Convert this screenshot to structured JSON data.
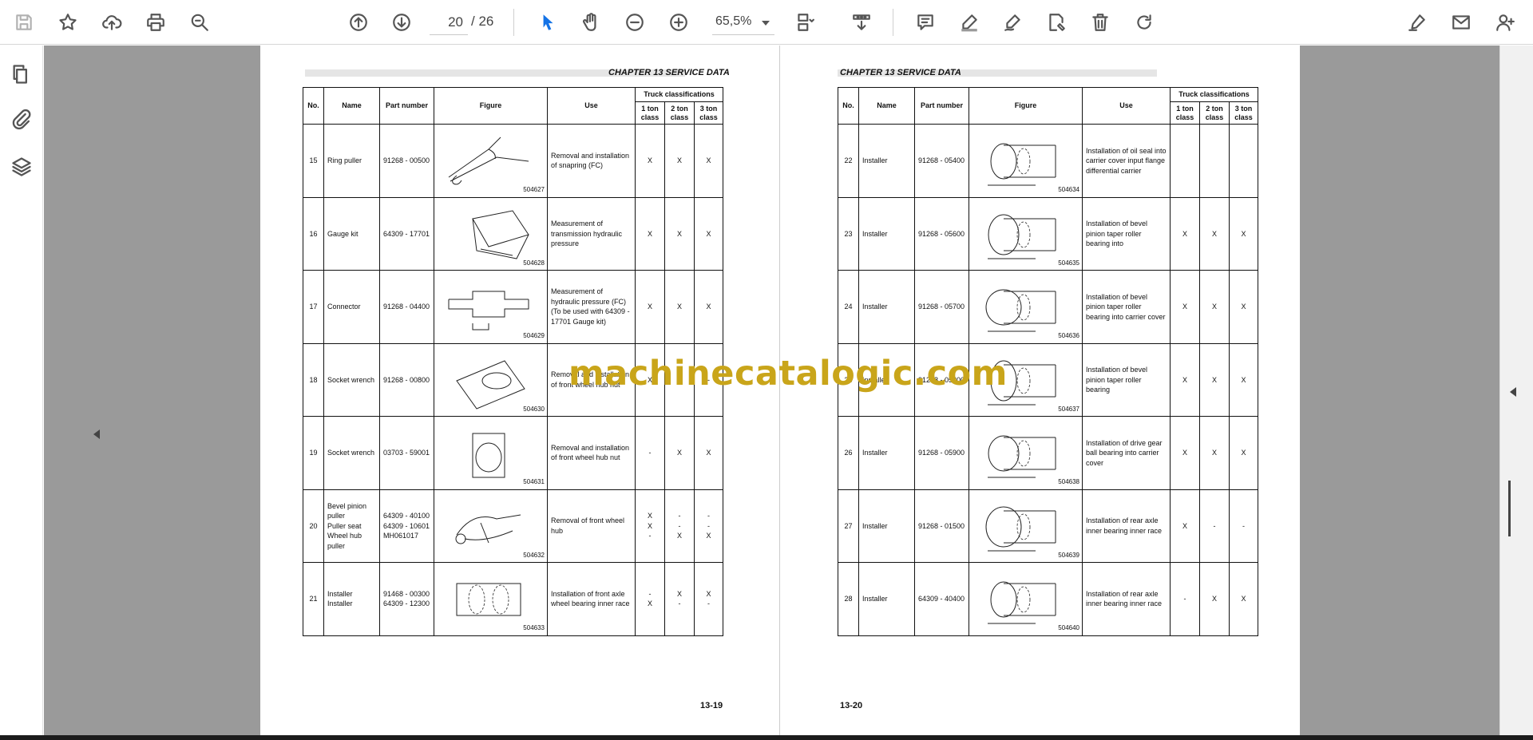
{
  "toolbar": {
    "page_current": "20",
    "page_total": "/  26",
    "zoom": "65,5%",
    "accent": "#1473e6"
  },
  "icons": {
    "toolbar": [
      "save-icon",
      "bookmark-star-icon",
      "upload-cloud-icon",
      "print-icon",
      "find-zoom-icon",
      "page-up-icon",
      "page-down-icon",
      "select-cursor-icon",
      "hand-tool-icon",
      "zoom-out-icon",
      "zoom-in-icon",
      "page-fit-icon",
      "scroll-mode-icon",
      "comment-icon",
      "highlight-pen-icon",
      "draw-icon",
      "stamp-icon",
      "delete-icon",
      "rotate-icon",
      "sign-icon",
      "email-icon",
      "add-user-icon"
    ],
    "sidebar": [
      "pages-icon",
      "attachments-icon",
      "layers-icon"
    ]
  },
  "document": {
    "header": "CHAPTER 13 SERVICE DATA",
    "columns": {
      "no": "No.",
      "name": "Name",
      "part": "Part number",
      "figure": "Figure",
      "use": "Use",
      "truck": "Truck classifications",
      "c1": "1 ton class",
      "c2": "2 ton class",
      "c3": "3 ton class"
    },
    "left_page": {
      "page_number": "13-19",
      "rows": [
        {
          "no": "15",
          "name": "Ring puller",
          "part": "91268 - 00500",
          "fig": "504627",
          "use": "Removal and installation of snapring (FC)",
          "c1": "X",
          "c2": "X",
          "c3": "X"
        },
        {
          "no": "16",
          "name": "Gauge kit",
          "part": "64309 - 17701",
          "fig": "504628",
          "use": "Measurement of transmission hydraulic pressure",
          "c1": "X",
          "c2": "X",
          "c3": "X"
        },
        {
          "no": "17",
          "name": "Connector",
          "part": "91268 - 04400",
          "fig": "504629",
          "use": "Measurement of hydraulic pressure (FC) (To be used with 64309 - 17701 Gauge kit)",
          "c1": "X",
          "c2": "X",
          "c3": "X"
        },
        {
          "no": "18",
          "name": "Socket wrench",
          "part": "91268 - 00800",
          "fig": "504630",
          "use": "Removal and installation of front wheel hub nut",
          "c1": "X",
          "c2": "-",
          "c3": "-"
        },
        {
          "no": "19",
          "name": "Socket wrench",
          "part": "03703 - 59001",
          "fig": "504631",
          "use": "Removal and installation of front wheel hub nut",
          "c1": "-",
          "c2": "X",
          "c3": "X"
        },
        {
          "no": "20",
          "name": "Bevel pinion puller\nPuller seat\nWheel hub puller",
          "part": "64309 - 40100\n64309 - 10601\nMH061017",
          "fig": "504632",
          "use": "Removal of front wheel hub",
          "c1": "X\nX\n-",
          "c2": "-\n-\nX",
          "c3": "-\n-\nX"
        },
        {
          "no": "21",
          "name": "Installer\nInstaller",
          "part": "91468 - 00300\n64309 - 12300",
          "fig": "504633",
          "use": "Installation of front axle wheel bearing inner race",
          "c1": "-\nX",
          "c2": "X\n-",
          "c3": "X\n-"
        }
      ]
    },
    "right_page": {
      "page_number": "13-20",
      "rows": [
        {
          "no": "22",
          "name": "Installer",
          "part": "91268 - 05400",
          "fig": "504634",
          "use": "Installation of oil seal into carrier cover input flange differential carrier",
          "c1": "",
          "c2": "",
          "c3": ""
        },
        {
          "no": "23",
          "name": "Installer",
          "part": "91268 - 05600",
          "fig": "504635",
          "use": "Installation of bevel pinion taper roller bearing into",
          "c1": "X",
          "c2": "X",
          "c3": "X"
        },
        {
          "no": "24",
          "name": "Installer",
          "part": "91268 - 05700",
          "fig": "504636",
          "use": "Installation of bevel pinion taper roller bearing into carrier cover",
          "c1": "X",
          "c2": "X",
          "c3": "X"
        },
        {
          "no": "25",
          "name": "Installer",
          "part": "91268 - 05800",
          "fig": "504637",
          "use": "Installation of bevel pinion taper roller bearing",
          "c1": "X",
          "c2": "X",
          "c3": "X"
        },
        {
          "no": "26",
          "name": "Installer",
          "part": "91268 - 05900",
          "fig": "504638",
          "use": "Installation of drive gear ball bearing into carrier cover",
          "c1": "X",
          "c2": "X",
          "c3": "X"
        },
        {
          "no": "27",
          "name": "Installer",
          "part": "91268 - 01500",
          "fig": "504639",
          "use": "Installation of rear axle inner bearing inner race",
          "c1": "X",
          "c2": "-",
          "c3": "-"
        },
        {
          "no": "28",
          "name": "Installer",
          "part": "64309 - 40400",
          "fig": "504640",
          "use": "Installation of rear axle inner bearing inner race",
          "c1": "-",
          "c2": "X",
          "c3": "X"
        }
      ]
    }
  },
  "watermark": {
    "text": "machinecatalogic.com",
    "color": "#c9a51a"
  }
}
